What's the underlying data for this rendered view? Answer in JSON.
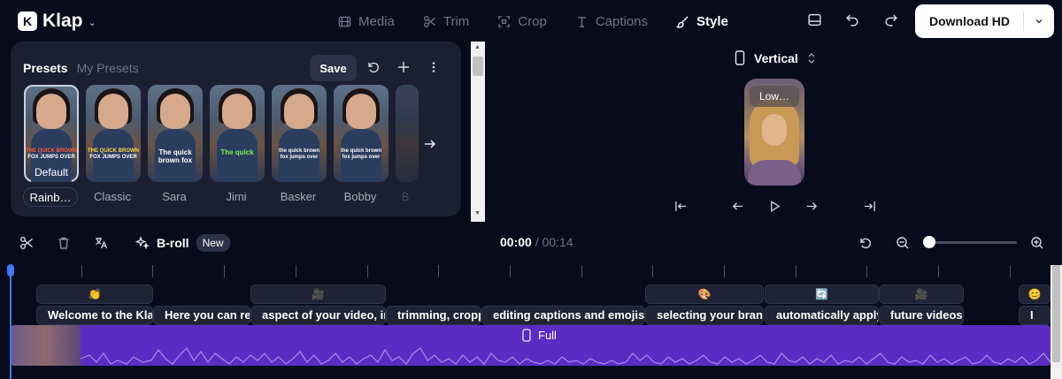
{
  "app": {
    "name": "Klap"
  },
  "nav": {
    "tabs": [
      {
        "label": "Media",
        "active": false
      },
      {
        "label": "Trim",
        "active": false
      },
      {
        "label": "Crop",
        "active": false
      },
      {
        "label": "Captions",
        "active": false
      },
      {
        "label": "Style",
        "active": true
      }
    ]
  },
  "header": {
    "download_label": "Download HD"
  },
  "presets": {
    "tabs": [
      {
        "label": "Presets",
        "active": true
      },
      {
        "label": "My Presets",
        "active": false
      }
    ],
    "save_label": "Save",
    "default_label": "Default",
    "cards": [
      {
        "name": "Rainb…",
        "selected": true,
        "caption": "THE QUICK BROWN",
        "caption2": "FOX JUMPS OVER",
        "color": "#ff5a3c"
      },
      {
        "name": "Classic",
        "selected": false,
        "caption": "THE QUICK BROWN",
        "caption2": "FOX JUMPS OVER",
        "color": "#ffd84a"
      },
      {
        "name": "Sara",
        "selected": false,
        "caption": "The quick",
        "caption2": "brown fox",
        "color": "#ffffff"
      },
      {
        "name": "Jimi",
        "selected": false,
        "caption": "The quick",
        "caption2": "",
        "color": "#7cf04a"
      },
      {
        "name": "Basker",
        "selected": false,
        "caption": "the quick brown",
        "caption2": "fox jumps over",
        "color": "#ffffff"
      },
      {
        "name": "Bobby",
        "selected": false,
        "caption": "the quick brown",
        "caption2": "fox jumps over",
        "color": "#ffffff"
      },
      {
        "name": "B",
        "selected": false,
        "caption": "",
        "caption2": "",
        "color": "#ffffff"
      }
    ]
  },
  "preview": {
    "aspect_label": "Vertical",
    "caption_text": "Low…"
  },
  "timeline": {
    "broll_label": "B-roll",
    "new_badge": "New",
    "current_time": "00:00",
    "separator": "/",
    "total_time": "00:14",
    "zoom_level": 0.03,
    "track_label": "Full",
    "emoji_clips": [
      {
        "emoji": "👏"
      },
      {
        "emoji": "🎥"
      },
      {
        "emoji": "🎨"
      },
      {
        "emoji": "🔄"
      },
      {
        "emoji": "🎥"
      },
      {
        "emoji": "😊"
      }
    ],
    "caption_clips": [
      "Welcome to the Klap",
      "Here you can refi",
      "aspect of your video, inc",
      "trimming, cropp",
      "editing captions and emojis, c",
      "selecting your brand",
      "automatically apply",
      "future videos c",
      "I"
    ]
  },
  "colors": {
    "background": "#080b1c",
    "panel": "#1a1f32",
    "track": "#5b2cc3",
    "playhead": "#3d7bf2",
    "accent_white": "#ffffff"
  }
}
